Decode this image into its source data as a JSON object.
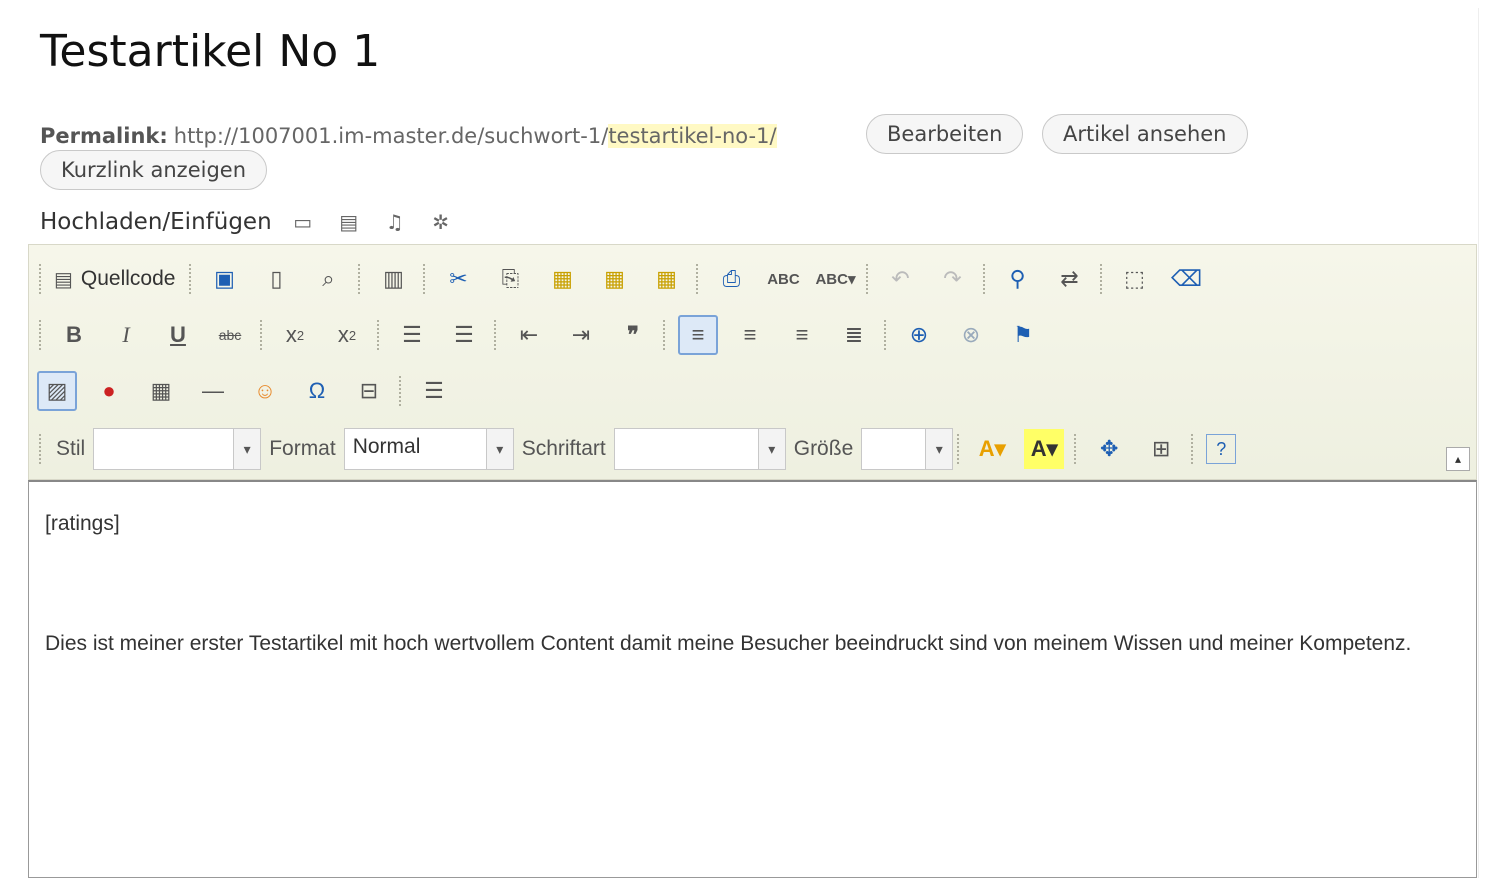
{
  "post": {
    "title": "Testartikel No 1"
  },
  "permalink": {
    "label": "Permalink:",
    "url_base": "http://1007001.im-master.de/suchwort-1/",
    "url_slug": "testartikel-no-1/",
    "edit_button": "Bearbeiten",
    "view_button": "Artikel ansehen",
    "shortlink_button": "Kurzlink anzeigen"
  },
  "upload": {
    "label": "Hochladen/Einfügen",
    "icons": [
      "image-icon",
      "video-icon",
      "audio-icon",
      "media-icon"
    ]
  },
  "toolbar": {
    "source_label": "Quellcode",
    "row1_icons": [
      "save-icon",
      "new-page-icon",
      "preview-icon",
      "templates-icon",
      "cut-icon",
      "copy-icon",
      "paste-icon",
      "paste-text-icon",
      "paste-word-icon",
      "print-icon",
      "spellcheck-icon",
      "scayt-icon",
      "undo-icon",
      "redo-icon",
      "find-icon",
      "replace-icon",
      "select-all-icon",
      "remove-format-icon"
    ],
    "row2_icons": [
      "bold-icon",
      "italic-icon",
      "underline-icon",
      "strike-icon",
      "subscript-icon",
      "superscript-icon",
      "numbered-list-icon",
      "bulleted-list-icon",
      "outdent-icon",
      "indent-icon",
      "blockquote-icon",
      "align-left-icon",
      "align-center-icon",
      "align-right-icon",
      "justify-icon",
      "link-icon",
      "unlink-icon",
      "anchor-icon"
    ],
    "row3_icons": [
      "image-insert-icon",
      "flash-icon",
      "table-icon",
      "horizontal-rule-icon",
      "smiley-icon",
      "special-char-icon",
      "page-break-icon",
      "more-tag-icon"
    ],
    "style_label": "Stil",
    "style_value": "",
    "format_label": "Format",
    "format_value": "Normal",
    "font_label": "Schriftart",
    "font_value": "",
    "size_label": "Größe",
    "size_value": "",
    "row4_icons": [
      "text-color-icon",
      "background-color-icon",
      "maximize-icon",
      "show-blocks-icon",
      "help-icon"
    ]
  },
  "editor": {
    "paragraph1": "[ratings]",
    "paragraph2": "Dies ist meiner erster Testartikel mit hoch wertvollem Content damit meine Besucher beeindruckt sind von meinem Wissen und meiner Kompetenz."
  }
}
